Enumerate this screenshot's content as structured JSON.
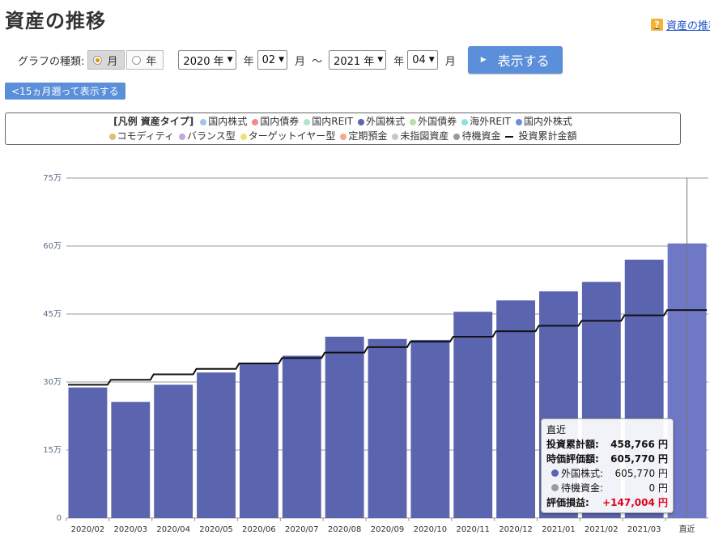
{
  "page": {
    "title": "資産の推移",
    "help_link": "資産の推移"
  },
  "controls": {
    "graph_type_label": "グラフの種類:",
    "toggle_month": "月",
    "toggle_year": "年",
    "start_year": "2020 年",
    "year_suffix_1": "年",
    "start_month": "02",
    "month_suffix_1": "月",
    "range_sep": "～",
    "end_year": "2021 年",
    "year_suffix_2": "年",
    "end_month": "04",
    "month_suffix_2": "月",
    "show_button": "表示する",
    "back_button": "<15ヵ月遡って表示する"
  },
  "legend": {
    "title": "[凡例 資産タイプ]",
    "items": [
      {
        "label": "国内株式",
        "color": "#a3c5e6"
      },
      {
        "label": "国内債券",
        "color": "#f08a8a"
      },
      {
        "label": "国内REIT",
        "color": "#aee6c8"
      },
      {
        "label": "外国株式",
        "color": "#5b64ae"
      },
      {
        "label": "外国債券",
        "color": "#b6e0a8"
      },
      {
        "label": "海外REIT",
        "color": "#8fe0e0"
      },
      {
        "label": "国内外株式",
        "color": "#6a8fd6"
      },
      {
        "label": "コモディティ",
        "color": "#d9c078"
      },
      {
        "label": "バランス型",
        "color": "#c4a8e0"
      },
      {
        "label": "ターゲットイヤー型",
        "color": "#f0e07a"
      },
      {
        "label": "定期預金",
        "color": "#f4a890"
      },
      {
        "label": "未指図資産",
        "color": "#c8c8c8"
      },
      {
        "label": "待機資金",
        "color": "#9a9a9a"
      },
      {
        "label": "投資累計金額",
        "color": "#111111"
      }
    ]
  },
  "chart_data": {
    "type": "bar",
    "categories": [
      "2020/02",
      "2020/03",
      "2020/04",
      "2020/05",
      "2020/06",
      "2020/07",
      "2020/08",
      "2020/09",
      "2020/10",
      "2020/11",
      "2020/12",
      "2021/01",
      "2021/02",
      "2021/03",
      "直近"
    ],
    "series": [
      {
        "name": "外国株式",
        "color": "#5b64ae",
        "values": [
          288000,
          256000,
          294000,
          321000,
          342000,
          358000,
          400000,
          395000,
          393000,
          455000,
          480000,
          500000,
          521000,
          570000,
          605770
        ]
      },
      {
        "name": "投資累計金額",
        "type": "step-line",
        "color": "#111111",
        "values": [
          294000,
          305000,
          317000,
          329000,
          341000,
          353000,
          365000,
          377000,
          389000,
          400000,
          412000,
          424000,
          435000,
          447000,
          458766
        ]
      }
    ],
    "y_ticks": [
      0,
      150000,
      300000,
      450000,
      600000,
      750000
    ],
    "y_tick_labels": [
      "0",
      "15万",
      "30万",
      "45万",
      "60万",
      "75万"
    ],
    "ylim": [
      0,
      750000
    ],
    "highlight_index": 14,
    "grid": true
  },
  "tooltip": {
    "title": "直近",
    "rows": [
      {
        "label": "投資累計額:",
        "value": "458,766 円",
        "bold": true
      },
      {
        "label": "時価評価額:",
        "value": "605,770 円",
        "bold": true
      },
      {
        "label": "外国株式:",
        "value": "605,770 円",
        "dot": "#5b64ae"
      },
      {
        "label": "待機資金:",
        "value": "0 円",
        "dot": "#9a9a9a"
      },
      {
        "label": "評価損益:",
        "value": "+147,004 円",
        "bold": true,
        "profit": true
      }
    ]
  }
}
